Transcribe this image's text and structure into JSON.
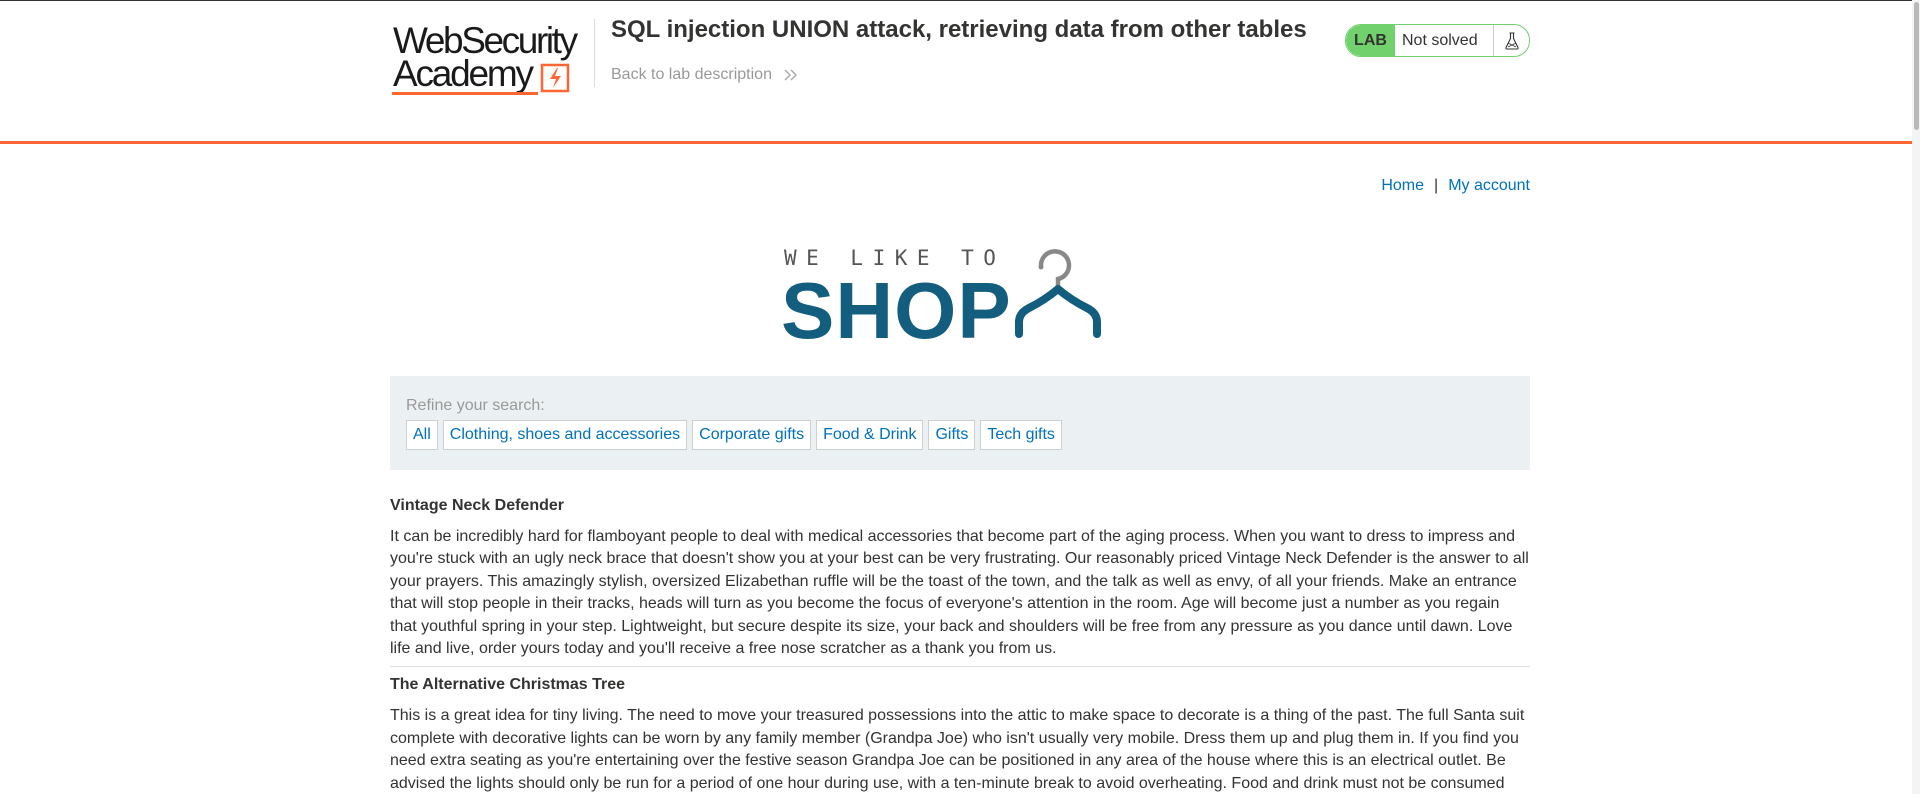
{
  "academy": {
    "logo_line1": "WebSecurity",
    "logo_line2": "Academy",
    "lab_title": "SQL injection UNION attack, retrieving data from other tables",
    "back_link": "Back to lab description",
    "status_badge": "LAB",
    "status_text": "Not solved"
  },
  "nav": {
    "home": "Home",
    "separator": "|",
    "account": "My account"
  },
  "shop_logo": {
    "tagline": "WE LIKE TO",
    "word": "SHOP"
  },
  "filter": {
    "label": "Refine your search:",
    "categories": [
      "All",
      "Clothing, shoes and accessories",
      "Corporate gifts",
      "Food & Drink",
      "Gifts",
      "Tech gifts"
    ]
  },
  "products": [
    {
      "name": "Vintage Neck Defender",
      "description": "It can be incredibly hard for flamboyant people to deal with medical accessories that become part of the aging process. When you want to dress to impress and you're stuck with an ugly neck brace that doesn't show you at your best can be very frustrating. Our reasonably priced Vintage Neck Defender is the answer to all your prayers. This amazingly stylish, oversized Elizabethan ruffle will be the toast of the town, and the talk as well as envy, of all your friends. Make an entrance that will stop people in their tracks, heads will turn as you become the focus of everyone's attention in the room. Age will become just a number as you regain that youthful spring in your step. Lightweight, but secure despite its size, your back and shoulders will be free from any pressure as you dance until dawn. Love life and live, order yours today and you'll receive a free nose scratcher as a thank you from us."
    },
    {
      "name": "The Alternative Christmas Tree",
      "description": "This is a great idea for tiny living. The need to move your treasured possessions into the attic to make space to decorate is a thing of the past. The full Santa suit complete with decorative lights can be worn by any family member (Grandpa Joe) who isn't usually very mobile. Dress them up and plug them in. If you find you need extra seating as you're entertaining over the festive season Grandpa Joe can be positioned in any area of the house where this is an electrical outlet. Be advised the lights should only be run for a period of one hour during use, with a ten-minute break to avoid overheating. Food and drink must not be consumed"
    }
  ],
  "colors": {
    "accent_orange": "#ff6633",
    "link_blue": "#0071bc",
    "status_green": "#70d16d",
    "shop_blue": "#135d7f",
    "filter_bg": "#ebf0f2"
  },
  "icons": {
    "back": "double-chevron-right-icon",
    "status": "flask-icon",
    "logo": "lightning-bolt-icon",
    "shop": "coat-hanger-icon"
  }
}
